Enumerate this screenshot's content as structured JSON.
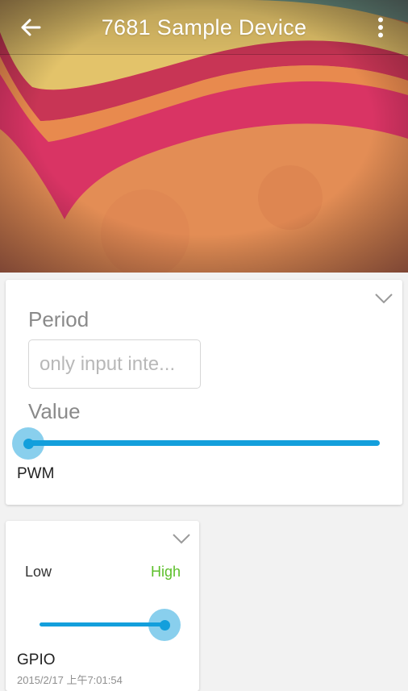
{
  "app": {
    "title": "7681 Sample Device",
    "back_icon": "arrow-left-icon",
    "menu_icon": "more-vertical-icon"
  },
  "pwm_card": {
    "period_label": "Period",
    "period_value": "",
    "period_placeholder": "only input inte...",
    "value_label": "Value",
    "slider_value": 0,
    "name": "PWM",
    "collapse_icon": "chevron-down-icon"
  },
  "gpio_card": {
    "low_label": "Low",
    "high_label": "High",
    "switch_state": "High",
    "name": "GPIO",
    "timestamp": "2015/2/17 上午7:01:54",
    "collapse_icon": "chevron-down-icon"
  },
  "colors": {
    "accent": "#139fdc",
    "high_text": "#5cbf2a",
    "background": "#f2f2f2"
  }
}
